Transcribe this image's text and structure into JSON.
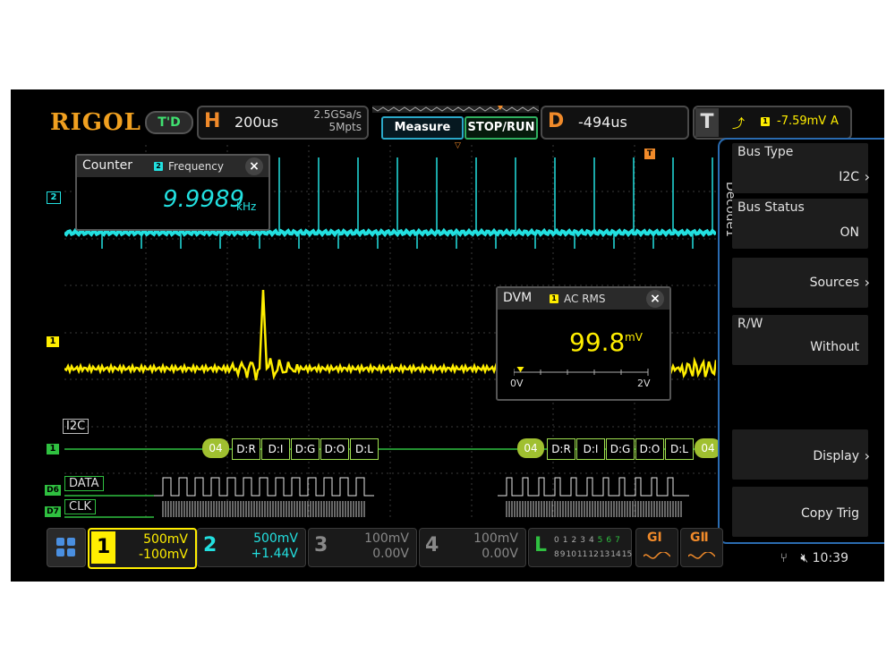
{
  "header": {
    "brand": "RIGOL",
    "mode_button": "T'D",
    "horizontal": {
      "letter": "H",
      "timebase": "200us",
      "sample_rate": "2.5GSa/s",
      "memory_depth": "5Mpts"
    },
    "measure_button": "Measure",
    "stop_run_button": "STOP/RUN",
    "delay": {
      "letter": "D",
      "value": "-494us"
    },
    "trigger": {
      "letter": "T",
      "channel": "1",
      "level": "-7.59mV",
      "mode": "A"
    }
  },
  "counter_popup": {
    "title": "Counter",
    "channel": "2",
    "subtitle": "Frequency",
    "value": "9.9989",
    "unit": "kHz"
  },
  "dvm_popup": {
    "title": "DVM",
    "channel": "1",
    "subtitle": "AC RMS",
    "value": "99.8",
    "unit": "mV",
    "scale_min": "0V",
    "scale_max": "2V",
    "level_fraction": 0.05
  },
  "bus": {
    "label": "I2C",
    "channel_marker": "1",
    "packets": [
      [
        "04",
        "D:R",
        "D:I",
        "D:G",
        "D:O",
        "D:L"
      ],
      [
        "04",
        "D:R",
        "D:I",
        "D:G",
        "D:O",
        "D:L",
        "04"
      ]
    ]
  },
  "digital": [
    {
      "marker": "D6",
      "label": "DATA"
    },
    {
      "marker": "D7",
      "label": "CLK"
    }
  ],
  "channel_markers": {
    "ch2": "2",
    "ch1": "1"
  },
  "side_menu": {
    "tab": "Decode1",
    "items": [
      {
        "label": "Bus Type",
        "value": "I2C"
      },
      {
        "label": "Bus Status",
        "value": "ON"
      },
      {
        "label": "",
        "value": "Sources"
      },
      {
        "label": "R/W",
        "value": "Without"
      },
      {
        "label": "",
        "value": "Display"
      },
      {
        "label": "",
        "value": "Copy Trig"
      }
    ]
  },
  "channels": [
    {
      "num": "1",
      "scale": "500mV",
      "offset": "-100mV",
      "color": "#ffee00"
    },
    {
      "num": "2",
      "scale": "500mV",
      "offset": "+1.44V",
      "color": "#22e0e0"
    },
    {
      "num": "3",
      "scale": "100mV",
      "offset": "0.00V",
      "color": "#888888"
    },
    {
      "num": "4",
      "scale": "100mV",
      "offset": "0.00V",
      "color": "#888888"
    }
  ],
  "logic": {
    "letter": "L",
    "row1": [
      "0",
      "1",
      "2",
      "3",
      "4",
      "5",
      "6",
      "7"
    ],
    "row2": [
      "8",
      "9",
      "10",
      "11",
      "12",
      "13",
      "14",
      "15"
    ]
  },
  "generators": [
    {
      "label": "GⅠ"
    },
    {
      "label": "GⅡ"
    }
  ],
  "status": {
    "time": "10:39"
  },
  "colors": {
    "ch1": "#ffee00",
    "ch2": "#22e0e0",
    "bus": "#a0e050",
    "accent": "#2a6bb0"
  }
}
